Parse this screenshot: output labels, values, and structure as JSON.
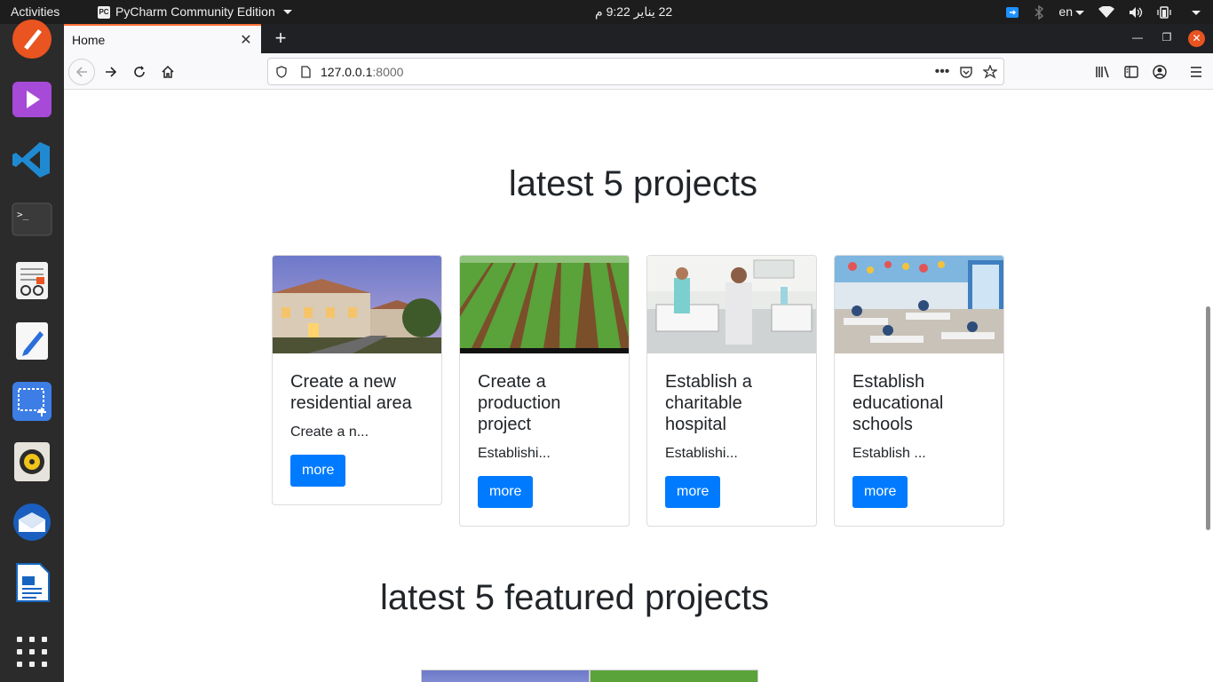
{
  "topbar": {
    "activities": "Activities",
    "app_name": "PyCharm Community Edition",
    "clock": "22 يناير  9:22 م",
    "lang": "en"
  },
  "browser": {
    "tab_title": "Home",
    "url_host": "127.0.0.1",
    "url_port": ":8000"
  },
  "page": {
    "latest_heading": "latest 5 projects",
    "featured_heading": "latest 5 featured projects",
    "projects": [
      {
        "title": "Create a new residential area",
        "excerpt": "Create a n...",
        "button": "more",
        "image": "residential-villas-image"
      },
      {
        "title": "Create a production project",
        "excerpt": "Establishi...",
        "button": "more",
        "image": "farm-field-image"
      },
      {
        "title": "Establish a charitable hospital",
        "excerpt": "Establishi...",
        "button": "more",
        "image": "hospital-ward-image"
      },
      {
        "title": "Establish educational schools",
        "excerpt": "Establish ...",
        "button": "more",
        "image": "classroom-image"
      }
    ]
  },
  "colors": {
    "accent": "#007bff",
    "firefox_tab_accent": "#ff7139",
    "ubuntu_orange": "#e95420"
  }
}
